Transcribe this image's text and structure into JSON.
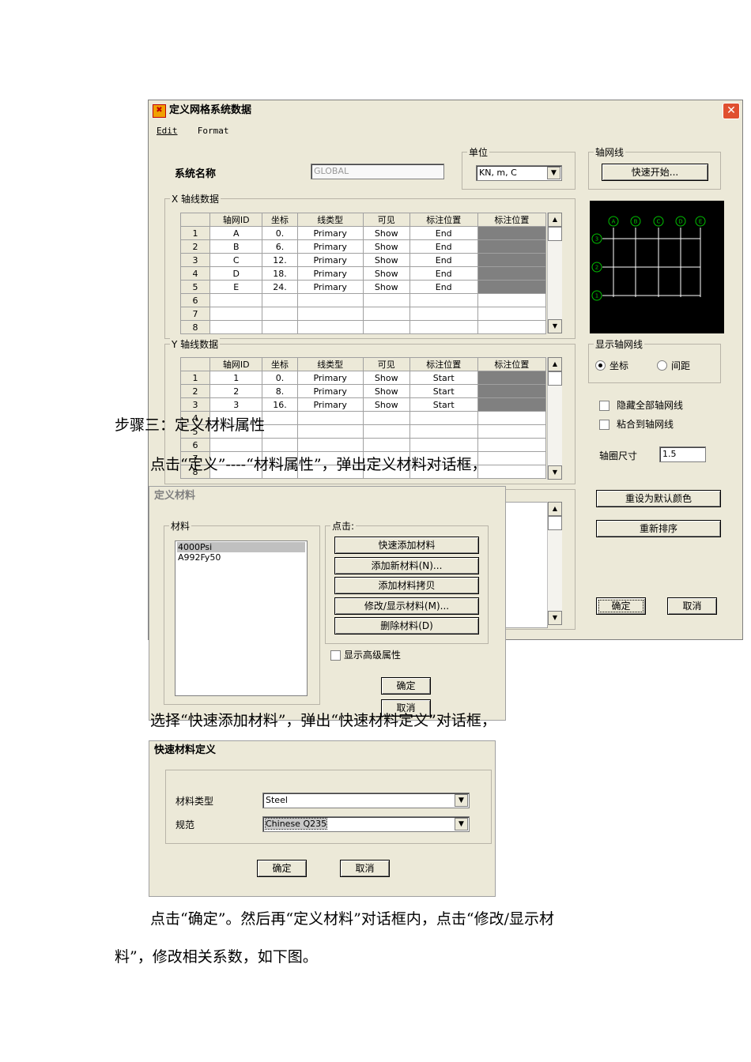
{
  "grid_dialog": {
    "title": "定义网格系统数据",
    "menu": [
      "Edit",
      "Format"
    ],
    "system_name_label": "系统名称",
    "system_name_value": "GLOBAL",
    "units_group": "单位",
    "units_value": "KN, m, C",
    "axis_group": "轴网线",
    "quick_start": "快速开始...",
    "x_group": "X 轴线数据",
    "y_group": "Y 轴线数据",
    "columns": [
      "轴网ID",
      "坐标",
      "线类型",
      "可见",
      "标注位置",
      "标注位置"
    ],
    "x_rows": [
      [
        "1",
        "A",
        "0.",
        "Primary",
        "Show",
        "End"
      ],
      [
        "2",
        "B",
        "6.",
        "Primary",
        "Show",
        "End"
      ],
      [
        "3",
        "C",
        "12.",
        "Primary",
        "Show",
        "End"
      ],
      [
        "4",
        "D",
        "18.",
        "Primary",
        "Show",
        "End"
      ],
      [
        "5",
        "E",
        "24.",
        "Primary",
        "Show",
        "End"
      ],
      [
        "6",
        "",
        "",
        "",
        "",
        ""
      ],
      [
        "7",
        "",
        "",
        "",
        "",
        ""
      ],
      [
        "8",
        "",
        "",
        "",
        "",
        ""
      ]
    ],
    "y_rows": [
      [
        "1",
        "1",
        "0.",
        "Primary",
        "Show",
        "Start"
      ],
      [
        "2",
        "2",
        "8.",
        "Primary",
        "Show",
        "Start"
      ],
      [
        "3",
        "3",
        "16.",
        "Primary",
        "Show",
        "Start"
      ],
      [
        "4",
        "",
        "",
        "",
        "",
        ""
      ],
      [
        "5",
        "",
        "",
        "",
        "",
        ""
      ],
      [
        "6",
        "",
        "",
        "",
        "",
        ""
      ],
      [
        "7",
        "",
        "",
        "",
        "",
        ""
      ],
      [
        "8",
        "",
        "",
        "",
        "",
        ""
      ]
    ],
    "preview_x_labels": [
      "A",
      "B",
      "C",
      "D",
      "E"
    ],
    "preview_y_labels": [
      "3",
      "2",
      "1"
    ],
    "display_group": "显示轴网线",
    "radio_coord": "坐标",
    "radio_spacing": "间距",
    "hide_all": "隐藏全部轴网线",
    "snap": "粘合到轴网线",
    "bubble_size_label": "轴圈尺寸",
    "bubble_size_value": "1.5",
    "reset_colors": "重设为默认颜色",
    "reorder": "重新排序",
    "ok": "确定",
    "cancel": "取消"
  },
  "doc_text": {
    "step3": "步骤三：定义材料属性",
    "para1": "点击“定义”----“材料属性”，弹出定义材料对话框，",
    "para2": "选择“快速添加材料”，弹出“快速材料定义”对话框，",
    "para3": "点击“确定”。然后再“定义材料”对话框内，点击“修改/显示材",
    "para4": "料”，修改相关系数，如下图。"
  },
  "material_dialog": {
    "title": "定义材料",
    "materials_group": "材料",
    "materials": [
      "4000Psi",
      "A992Fy50"
    ],
    "click_group": "点击:",
    "buttons": [
      "快速添加材料",
      "添加新材料(N)...",
      "添加材料拷贝",
      "修改/显示材料(M)...",
      "删除材料(D)"
    ],
    "show_advanced": "显示高级属性",
    "ok": "确定",
    "cancel": "取消"
  },
  "quick_material_dialog": {
    "title": "快速材料定义",
    "type_label": "材料类型",
    "type_value": "Steel",
    "code_label": "规范",
    "code_value": "Chinese Q235",
    "ok": "确定",
    "cancel": "取消"
  },
  "colors": {
    "preview_bg": "#000000",
    "preview_line": "#ffffff",
    "bubble": "#00c000",
    "dark_cell": "#808080"
  }
}
